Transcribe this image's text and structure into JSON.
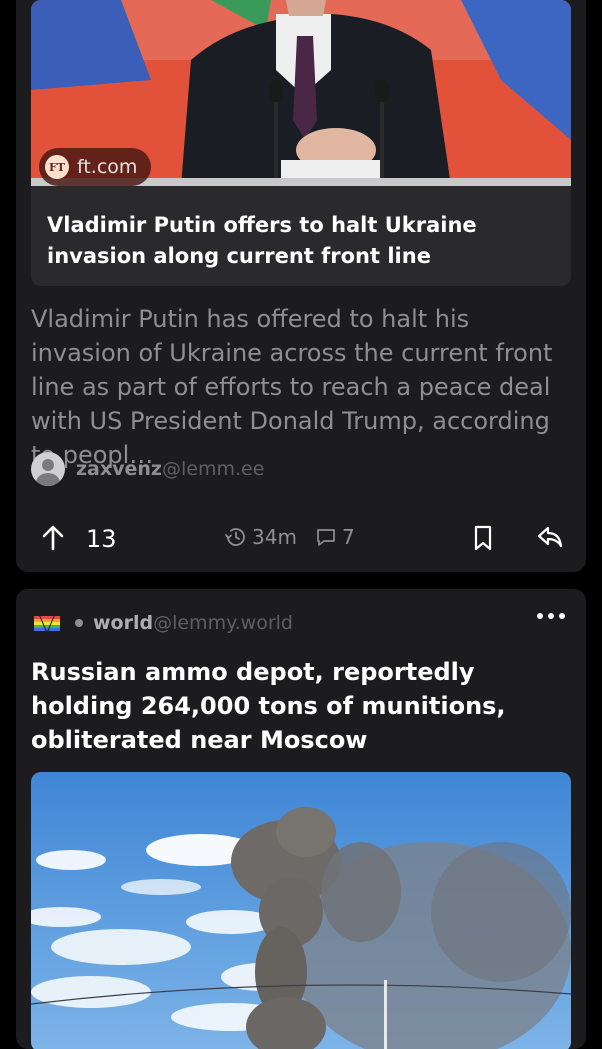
{
  "post1": {
    "link": {
      "domain": "ft.com",
      "logo_text": "FT",
      "title": "Vladimir Putin offers to halt Ukraine invasion along current front line"
    },
    "excerpt": "Vladimir Putin has offered to halt his invasion of Ukraine across the current front line as part of efforts to reach a peace deal with US President Donald Trump, according to peopl…",
    "author": {
      "name": "zaxvenz",
      "instance": "@lemm.ee"
    },
    "actions": {
      "score": "13",
      "age": "34m",
      "comments": "7"
    }
  },
  "post2": {
    "community": {
      "name": "world",
      "instance": "@lemmy.world"
    },
    "title": "Russian ammo depot, reportedly holding 264,000 tons of munitions, obliterated near Moscow"
  },
  "colors": {
    "background": "#000000",
    "card": "#1c1c1e",
    "embed": "#2a2a2d",
    "secondary_text": "#8e8e93",
    "tertiary_text": "#5f5f64"
  }
}
